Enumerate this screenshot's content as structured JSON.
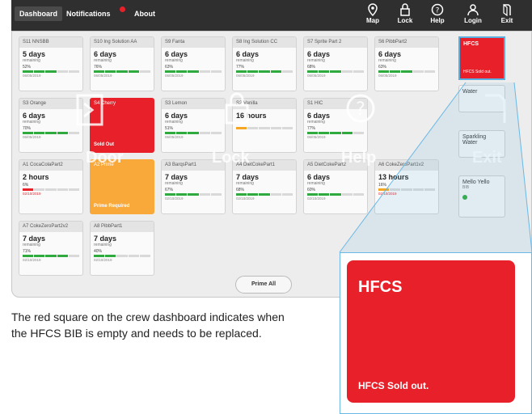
{
  "nav": {
    "tabs": [
      "Dashboard",
      "Notifications",
      "About"
    ],
    "right": [
      {
        "label": "Map",
        "icon": "map-pin-icon"
      },
      {
        "label": "Lock",
        "icon": "lock-icon"
      },
      {
        "label": "Help",
        "icon": "help-icon"
      },
      {
        "label": "Login",
        "icon": "user-icon"
      },
      {
        "label": "Exit",
        "icon": "exit-icon"
      }
    ]
  },
  "cards": [
    {
      "name": "S11 NNSBB",
      "value": "5 days",
      "sub": "remaining",
      "pct": "52%",
      "fill": 0.52,
      "date": "06/05/2019",
      "state": "normal"
    },
    {
      "name": "S10 Ing Solution AA",
      "value": "6 days",
      "sub": "remaining",
      "pct": "76%",
      "fill": 0.76,
      "date": "06/05/2019",
      "state": "normal"
    },
    {
      "name": "S9 Fanta",
      "value": "6 days",
      "sub": "remaining",
      "pct": "63%",
      "fill": 0.63,
      "date": "06/05/2019",
      "state": "normal"
    },
    {
      "name": "S8 Ing Solution CC",
      "value": "6 days",
      "sub": "remaining",
      "pct": "77%",
      "fill": 0.77,
      "date": "06/05/2019",
      "state": "normal"
    },
    {
      "name": "S7 Sprite Part 2",
      "value": "6 days",
      "sub": "remaining",
      "pct": "68%",
      "fill": 0.68,
      "date": "06/05/2019",
      "state": "normal"
    },
    {
      "name": "S6 PibbPart2",
      "value": "6 days",
      "sub": "remaining",
      "pct": "63%",
      "fill": 0.63,
      "date": "06/05/2019",
      "state": "normal"
    },
    {
      "name": "S3 Orange",
      "value": "6 days",
      "sub": "remaining",
      "pct": "70%",
      "fill": 0.7,
      "date": "06/05/2019",
      "state": "normal"
    },
    {
      "name": "S4 Cherry",
      "value": "",
      "sub": "",
      "pct": "",
      "fill": 0,
      "date": "",
      "state": "red",
      "foot": "Sold Out"
    },
    {
      "name": "S3 Lemon",
      "value": "6 days",
      "sub": "remaining",
      "pct": "51%",
      "fill": 0.51,
      "date": "06/05/2019",
      "state": "normal"
    },
    {
      "name": "S2 Vanilla",
      "value": "16 hours",
      "sub": "",
      "pct": "",
      "fill": 0.1,
      "date": "",
      "state": "orangebar"
    },
    {
      "name": "S1 HIC",
      "value": "6 days",
      "sub": "remaining",
      "pct": "77%",
      "fill": 0.77,
      "date": "06/05/2019",
      "state": "normal"
    },
    {
      "name": "A1 CocaColaPart2",
      "value": "2 hours",
      "sub": "",
      "pct": "6%",
      "fill": 0.06,
      "date": "02/10/2019",
      "state": "redbar"
    },
    {
      "name": "A2 Prime",
      "value": "",
      "sub": "",
      "pct": "",
      "fill": 0,
      "date": "",
      "state": "orange",
      "foot": "Prime Required"
    },
    {
      "name": "A3 BarqsPart1",
      "value": "7 days",
      "sub": "remaining",
      "pct": "67%",
      "fill": 0.67,
      "date": "02/10/2019",
      "state": "normal"
    },
    {
      "name": "A4 DietCokePart1",
      "value": "7 days",
      "sub": "remaining",
      "pct": "68%",
      "fill": 0.68,
      "date": "02/10/2019",
      "state": "normal"
    },
    {
      "name": "A5 DietCokePart2",
      "value": "6 days",
      "sub": "remaining",
      "pct": "60%",
      "fill": 0.6,
      "date": "02/10/2019",
      "state": "normal"
    },
    {
      "name": "A6 CokeZeroPart1v2",
      "value": "13 hours",
      "sub": "",
      "pct": "16%",
      "fill": 0.16,
      "date": "02/10/2019",
      "state": "orangebar"
    },
    {
      "name": "A7 CokeZeroPart2v2",
      "value": "7 days",
      "sub": "remaining",
      "pct": "71%",
      "fill": 0.71,
      "date": "02/10/2019",
      "state": "normal"
    },
    {
      "name": "A8 PibbPart1",
      "value": "7 days",
      "sub": "remaining",
      "pct": "40%",
      "fill": 0.4,
      "date": "02/10/2019",
      "state": "normal"
    }
  ],
  "side": {
    "hfcs_title": "HFCS",
    "hfcs_sub": "HFCS Sold out.",
    "water": "Water",
    "sparkling": "Sparkling Water",
    "mello": "Mello Yello",
    "mello_sub": "BIB"
  },
  "prime_all": "Prime All",
  "overlay": {
    "door": "Door",
    "lock": "Lock",
    "help": "Help",
    "exit": "Exit"
  },
  "zoom": {
    "title": "HFCS",
    "sub": "HFCS Sold out."
  },
  "caption": "The red square on the crew dashboard indicates when the HFCS BIB is empty and needs to be replaced.",
  "colors": {
    "sold_out": "#e8202a",
    "prime": "#f9a83a",
    "level_ok": "#2eaa3e",
    "callout_border": "#69b8e6"
  }
}
